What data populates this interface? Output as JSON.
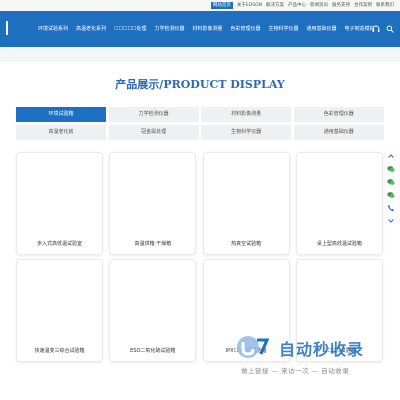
{
  "topbar": {
    "links": [
      "网站首页",
      "关于EDSON",
      "解决方案",
      "产品中心",
      "新闻资讯",
      "服务支持",
      "合作案例",
      "联系我们"
    ],
    "active_index": 0
  },
  "nav": {
    "items": [
      "环境试验系列",
      "高温老化系列",
      "☐☐☐☐☐处理",
      "力学检测仪器",
      "材料影像测量",
      "色彩管理仪器",
      "生物科学仪器",
      "通用基础仪器",
      "电子制造模拟"
    ],
    "icons": [
      "headset-icon",
      "search-icon"
    ],
    "note": "One string is partly illegible in the screenshot; ☐ marks each character that could not be read."
  },
  "section": {
    "title": "产品展示/PRODUCT DISPLAY"
  },
  "categories": [
    {
      "label": "环境试验箱",
      "active": true
    },
    {
      "label": "力学检测仪器",
      "active": false
    },
    {
      "label": "材料影像测量",
      "active": false
    },
    {
      "label": "色彩管理仪器",
      "active": false
    },
    {
      "label": "高温老化房",
      "active": false
    },
    {
      "label": "冠金属处理",
      "active": false
    },
    {
      "label": "生物科学仪器",
      "active": false
    },
    {
      "label": "通用基础仪器",
      "active": false
    }
  ],
  "products": [
    {
      "label": "步入式高低温试验室"
    },
    {
      "label": "高温烘箱·干燥箱"
    },
    {
      "label": "热真空试验箱"
    },
    {
      "label": "桌上型高低温试验箱"
    },
    {
      "label": "快速温变三综合试验箱"
    },
    {
      "label": "ESO二氧化硫试验箱"
    },
    {
      "label": "IPX☐☐☐☐试验箱"
    },
    {
      "label": "☐☐☐☐试验箱"
    }
  ],
  "sidebar": {
    "icons": [
      "arrow-up-icon",
      "wechat-icon",
      "wechat-icon",
      "wechat-icon",
      "phone-icon",
      "arrow-down-icon"
    ]
  },
  "watermark": {
    "text": "自动秒收录",
    "sub": "做上链接 — 来访一次 — 自动收录"
  },
  "colors": {
    "nav_bg": "#1f6fbf",
    "accent": "#1d6fc2",
    "title": "#2c68b4"
  }
}
